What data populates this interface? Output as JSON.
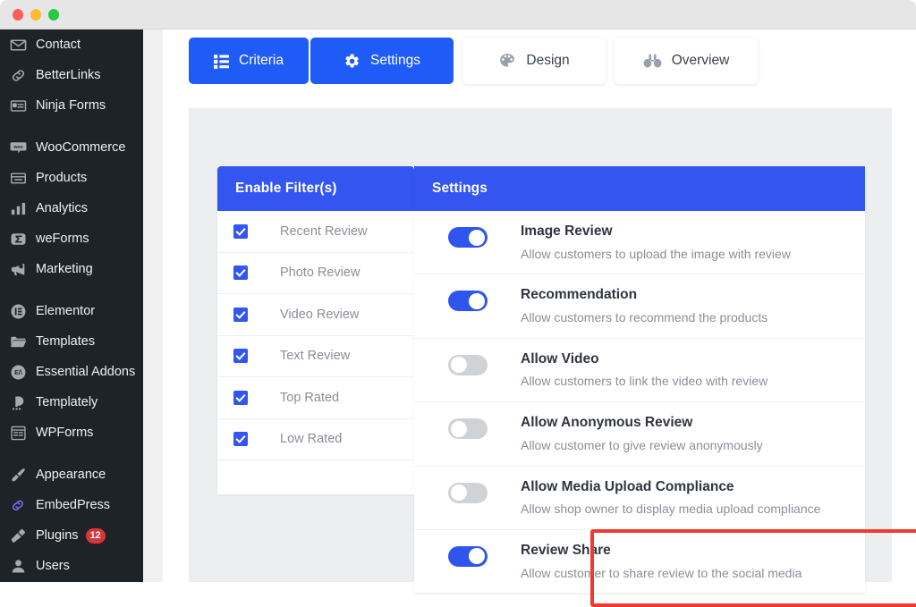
{
  "window": {
    "traffic_lights": [
      "close",
      "minimize",
      "maximize"
    ]
  },
  "sidebar": {
    "items": [
      {
        "label": "Contact",
        "icon": "mail-icon",
        "badge": null
      },
      {
        "label": "BetterLinks",
        "icon": "link-icon",
        "badge": null
      },
      {
        "label": "Ninja Forms",
        "icon": "form-icon",
        "badge": null
      },
      {
        "label": "WooCommerce",
        "icon": "woocommerce-icon",
        "badge": null
      },
      {
        "label": "Products",
        "icon": "box-icon",
        "badge": null
      },
      {
        "label": "Analytics",
        "icon": "bar-chart-icon",
        "badge": null
      },
      {
        "label": "weForms",
        "icon": "weforms-icon",
        "badge": null
      },
      {
        "label": "Marketing",
        "icon": "megaphone-icon",
        "badge": null
      },
      {
        "label": "Elementor",
        "icon": "elementor-icon",
        "badge": null
      },
      {
        "label": "Templates",
        "icon": "folder-icon",
        "badge": null
      },
      {
        "label": "Essential Addons",
        "icon": "ea-icon",
        "badge": null
      },
      {
        "label": "Templately",
        "icon": "templately-icon",
        "badge": null
      },
      {
        "label": "WPForms",
        "icon": "wpforms-icon",
        "badge": null
      },
      {
        "label": "Appearance",
        "icon": "brush-icon",
        "badge": null
      },
      {
        "label": "EmbedPress",
        "icon": "embedpress-icon",
        "badge": null
      },
      {
        "label": "Plugins",
        "icon": "plug-icon",
        "badge": "12"
      },
      {
        "label": "Users",
        "icon": "user-icon",
        "badge": null
      }
    ]
  },
  "tabs": [
    {
      "label": "Criteria",
      "icon": "list-icon",
      "active": true
    },
    {
      "label": "Settings",
      "icon": "gear-icon",
      "active": true
    },
    {
      "label": "Design",
      "icon": "palette-icon",
      "active": false
    },
    {
      "label": "Overview",
      "icon": "binoculars-icon",
      "active": false
    }
  ],
  "filters_panel": {
    "header": "Enable Filter(s)",
    "items": [
      {
        "label": "Recent Review",
        "checked": true
      },
      {
        "label": "Photo Review",
        "checked": true
      },
      {
        "label": "Video Review",
        "checked": true
      },
      {
        "label": "Text Review",
        "checked": true
      },
      {
        "label": "Top Rated",
        "checked": true
      },
      {
        "label": "Low Rated",
        "checked": true
      }
    ]
  },
  "settings_panel": {
    "header": "Settings",
    "items": [
      {
        "title": "Image Review",
        "desc": "Allow customers to upload the image with review",
        "enabled": true,
        "highlighted": false
      },
      {
        "title": "Recommendation",
        "desc": "Allow customers to recommend the products",
        "enabled": true,
        "highlighted": false
      },
      {
        "title": "Allow Video",
        "desc": "Allow customers to link the video with review",
        "enabled": false,
        "highlighted": false
      },
      {
        "title": "Allow Anonymous Review",
        "desc": "Allow customer to give review anonymously",
        "enabled": false,
        "highlighted": false
      },
      {
        "title": "Allow Media Upload Compliance",
        "desc": "Allow shop owner to display media upload compliance",
        "enabled": false,
        "highlighted": false
      },
      {
        "title": "Review Share",
        "desc": "Allow customer to share review to the social media",
        "enabled": true,
        "highlighted": true
      }
    ]
  },
  "colors": {
    "accent_blue": "#3355f0",
    "tab_blue": "#1f5bf6",
    "toggle_on": "#2f55ef",
    "toggle_off": "#cfd2d6",
    "sidebar_bg": "#1d2327",
    "badge_red": "#d63638",
    "highlight_red": "#f03a2f"
  }
}
